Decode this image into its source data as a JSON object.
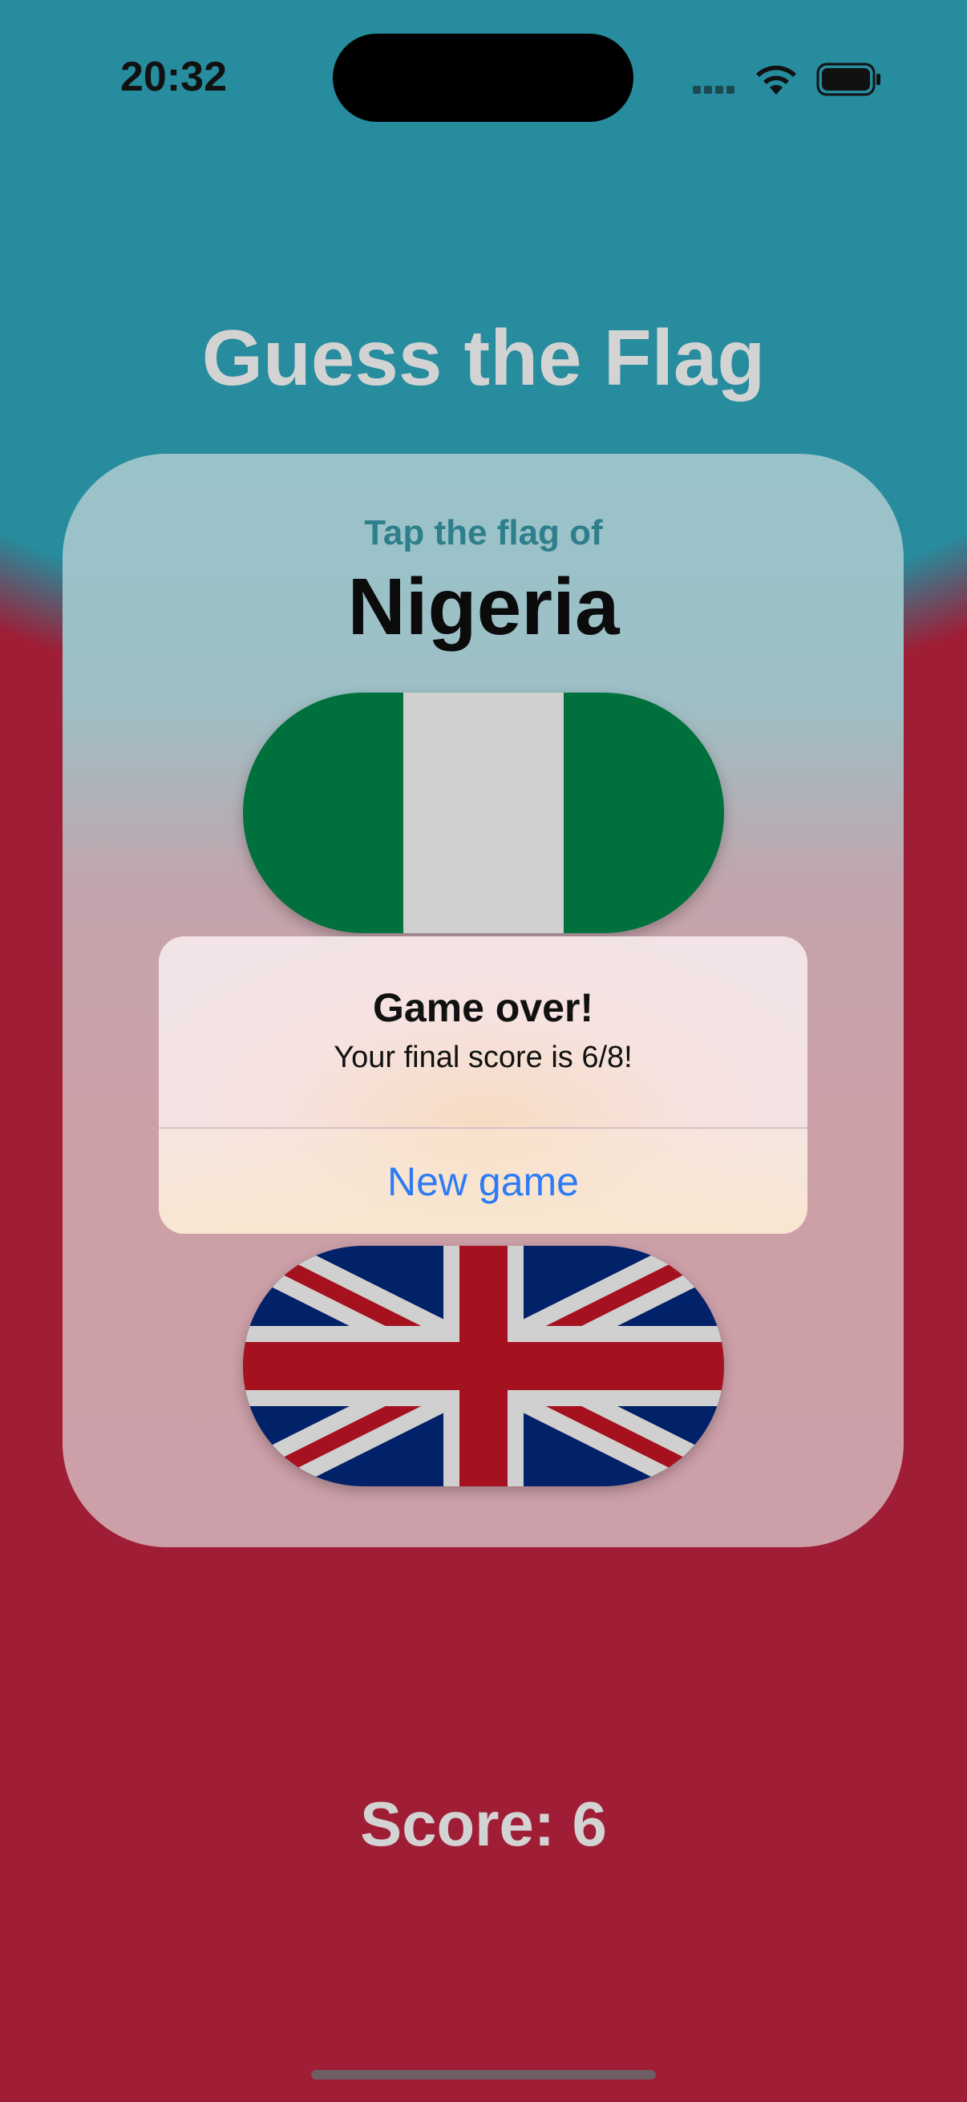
{
  "status_bar": {
    "time": "20:32",
    "icons": [
      "signal-icon",
      "wifi-icon",
      "battery-icon"
    ]
  },
  "app": {
    "title": "Guess the Flag",
    "prompt": "Tap the flag of",
    "country": "Nigeria",
    "score_label": "Score: 6"
  },
  "flags": [
    {
      "name": "nigeria-flag",
      "colors": [
        "#00703c",
        "#d0d0d0",
        "#00703c"
      ]
    },
    {
      "name": "uk-flag",
      "colors": [
        "#012169",
        "#d0d0d0",
        "#a6111f"
      ]
    }
  ],
  "alert": {
    "title": "Game over!",
    "message": "Your final score is 6/8!",
    "button_label": "New game"
  },
  "colors": {
    "top_background": "#268c9e",
    "bottom_background": "#9f1d35",
    "title_text": "#d3d3d3",
    "accent_button": "#2d7cf6"
  }
}
